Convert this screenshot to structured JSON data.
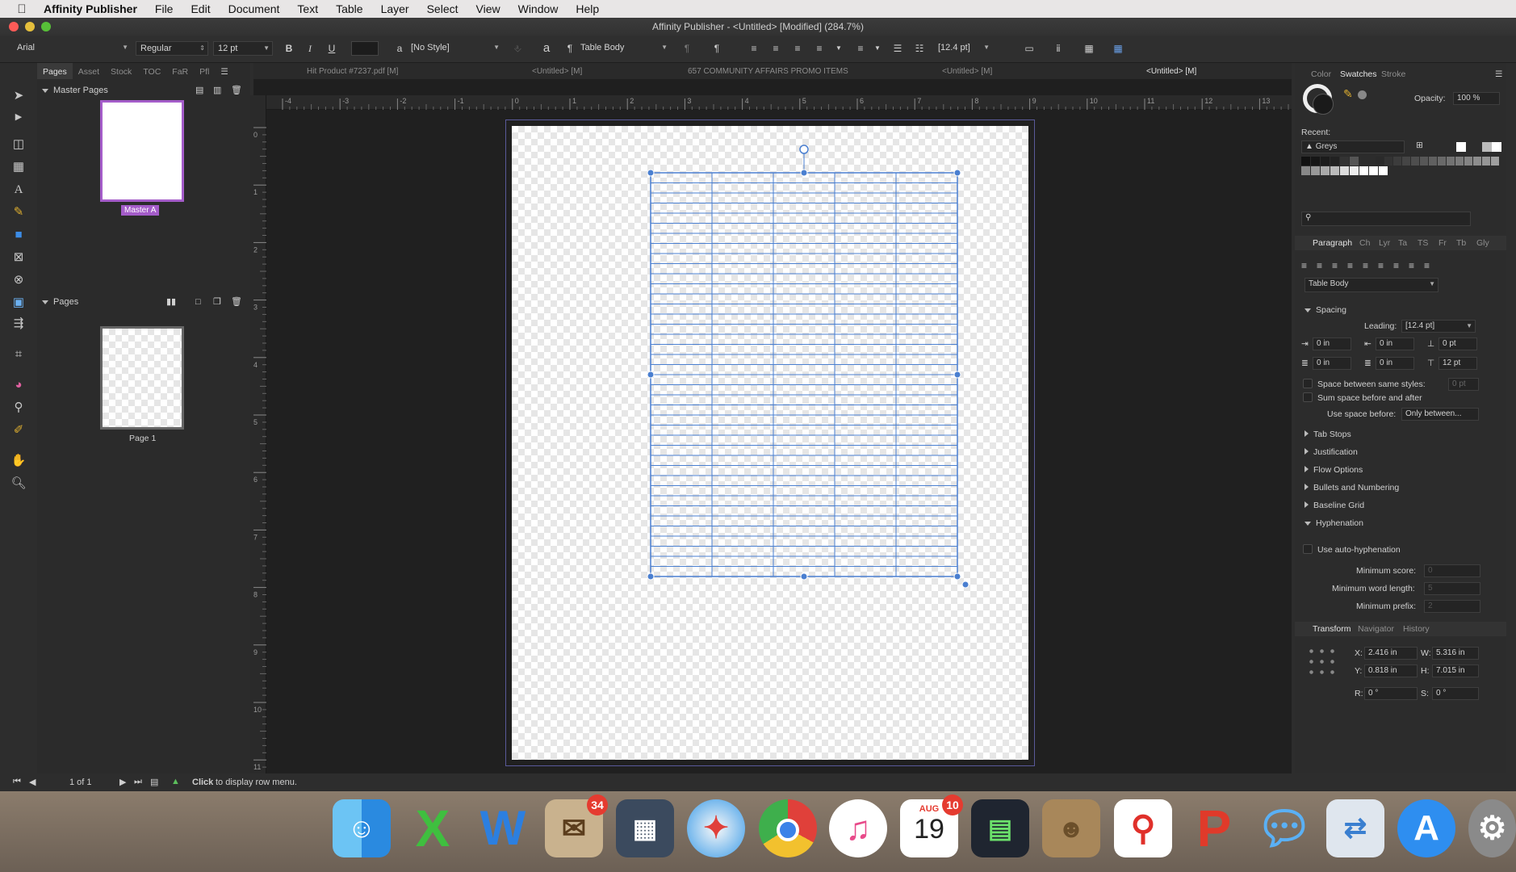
{
  "menubar": {
    "app_name": "Affinity Publisher",
    "items": [
      "File",
      "Edit",
      "Document",
      "Text",
      "Table",
      "Layer",
      "Select",
      "View",
      "Window",
      "Help"
    ]
  },
  "window": {
    "title": "Affinity Publisher - <Untitled> [Modified] (284.7%)"
  },
  "toolbar": {
    "font": "Arial",
    "style": "Regular",
    "size": "12 pt",
    "bold": "B",
    "italic": "I",
    "underline": "U",
    "char_style": "[No Style]",
    "para_style": "Table Body",
    "leading": "[12.4 pt]"
  },
  "left_panel": {
    "tabs": [
      "Pages",
      "Asset",
      "Stock",
      "TOC",
      "FaR",
      "Pfl"
    ],
    "master_section": "Master Pages",
    "master_label": "Master A",
    "pages_section": "Pages",
    "page_label": "Page 1"
  },
  "doc_tabs": [
    "Hit Product #7237.pdf [M]",
    "<Untitled> [M]",
    "657 COMMUNITY AFFAIRS PROMO ITEMS",
    "<Untitled> [M]",
    "<Untitled> [M]"
  ],
  "ruler": {
    "h_labels": [
      "-4",
      "-3",
      "-2",
      "-1",
      "0",
      "1",
      "2",
      "3",
      "4",
      "5",
      "6",
      "7",
      "8",
      "9",
      "10",
      "11",
      "12",
      "13"
    ],
    "v_labels": [
      "0",
      "1",
      "2",
      "3",
      "4",
      "5",
      "6",
      "7",
      "8",
      "9",
      "10",
      "11"
    ]
  },
  "table": {
    "columns": 5,
    "rows": 40
  },
  "right_panel": {
    "color_tabs": [
      "Color",
      "Swatches",
      "Stroke"
    ],
    "opacity_label": "Opacity:",
    "opacity_value": "100 %",
    "recent_label": "Recent:",
    "palette": "Greys",
    "para_tabs": [
      "Paragraph",
      "Ch",
      "Lyr",
      "Ta",
      "TS",
      "Fr",
      "Tb",
      "Gly"
    ],
    "para_style": "Table Body",
    "spacing_title": "Spacing",
    "leading_label": "Leading:",
    "leading_value": "[12.4 pt]",
    "indent_left": "0 in",
    "indent_right": "0 in",
    "space_before": "0 pt",
    "first_line": "0 in",
    "last_line": "0 in",
    "space_after": "12 pt",
    "space_between_label": "Space between same styles:",
    "space_between_value": "0 pt",
    "sum_space_label": "Sum space before and after",
    "use_space_label": "Use space before:",
    "use_space_value": "Only between...",
    "sections": [
      "Tab Stops",
      "Justification",
      "Flow Options",
      "Bullets and Numbering",
      "Baseline Grid"
    ],
    "hyphenation_title": "Hyphenation",
    "auto_hyph_label": "Use auto-hyphenation",
    "min_score_label": "Minimum score:",
    "min_score_value": "0",
    "min_word_label": "Minimum word length:",
    "min_word_value": "5",
    "min_prefix_label": "Minimum prefix:",
    "min_prefix_value": "2",
    "transform_tabs": [
      "Transform",
      "Navigator",
      "History"
    ],
    "x_label": "X:",
    "x_value": "2.416 in",
    "w_label": "W:",
    "w_value": "5.316 in",
    "y_label": "Y:",
    "y_value": "0.818 in",
    "h_label": "H:",
    "h_value": "7.015 in",
    "r_label": "R:",
    "r_value": "0 °",
    "s_label": "S:",
    "s_value": "0 °"
  },
  "status": {
    "page_count": "1 of 1",
    "hint_bold": "Click",
    "hint": "to display row menu."
  },
  "dock": {
    "mail_badge": "34",
    "calendar_month": "AUG",
    "calendar_day": "19",
    "calendar_badge": "10"
  },
  "colors": {
    "selection": "#4a7fd0",
    "master_highlight": "#a45cc9",
    "badge": "#e53b30"
  }
}
